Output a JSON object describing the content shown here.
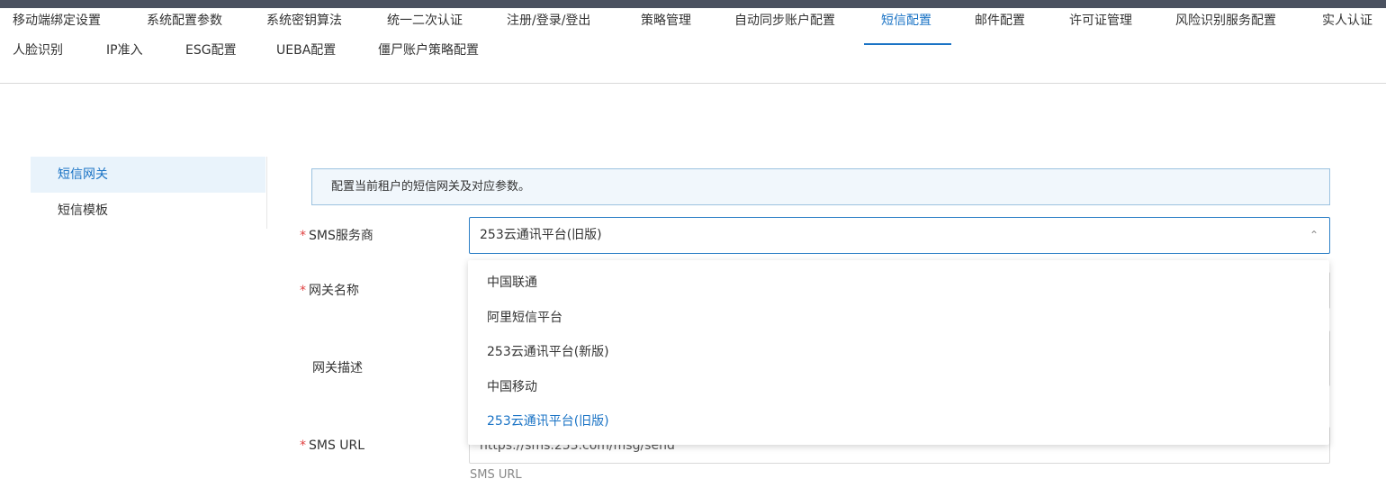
{
  "tabs": [
    "移动端绑定设置",
    "系统配置参数",
    "系统密钥算法",
    "统一二次认证",
    "注册/登录/登出",
    "策略管理",
    "自动同步账户配置",
    "短信配置",
    "邮件配置",
    "许可证管理",
    "风险识别服务配置",
    "实人认证",
    "人脸识别",
    "IP准入",
    "ESG配置",
    "UEBA配置",
    "僵尸账户策略配置"
  ],
  "active_tab": "短信配置",
  "sidebar": {
    "items": [
      "短信网关",
      "短信模板"
    ],
    "active": "短信网关"
  },
  "notice": "配置当前租户的短信网关及对应参数。",
  "form": {
    "required_mark": "*",
    "provider_label": "SMS服务商",
    "provider_value": "253云通讯平台(旧版)",
    "gateway_name_label": "网关名称",
    "gateway_desc_label": "网关描述",
    "sms_url_label": "SMS URL",
    "sms_url_value": "https://sms.253.com/msg/send",
    "sms_url_hint": "SMS URL"
  },
  "dropdown": {
    "options": [
      "中国联通",
      "阿里短信平台",
      "253云通讯平台(新版)",
      "中国移动",
      "253云通讯平台(旧版)"
    ],
    "selected": "253云通讯平台(旧版)"
  },
  "colors": {
    "accent": "#1a73c5",
    "required": "#e04040",
    "topbar": "#4a5160"
  }
}
